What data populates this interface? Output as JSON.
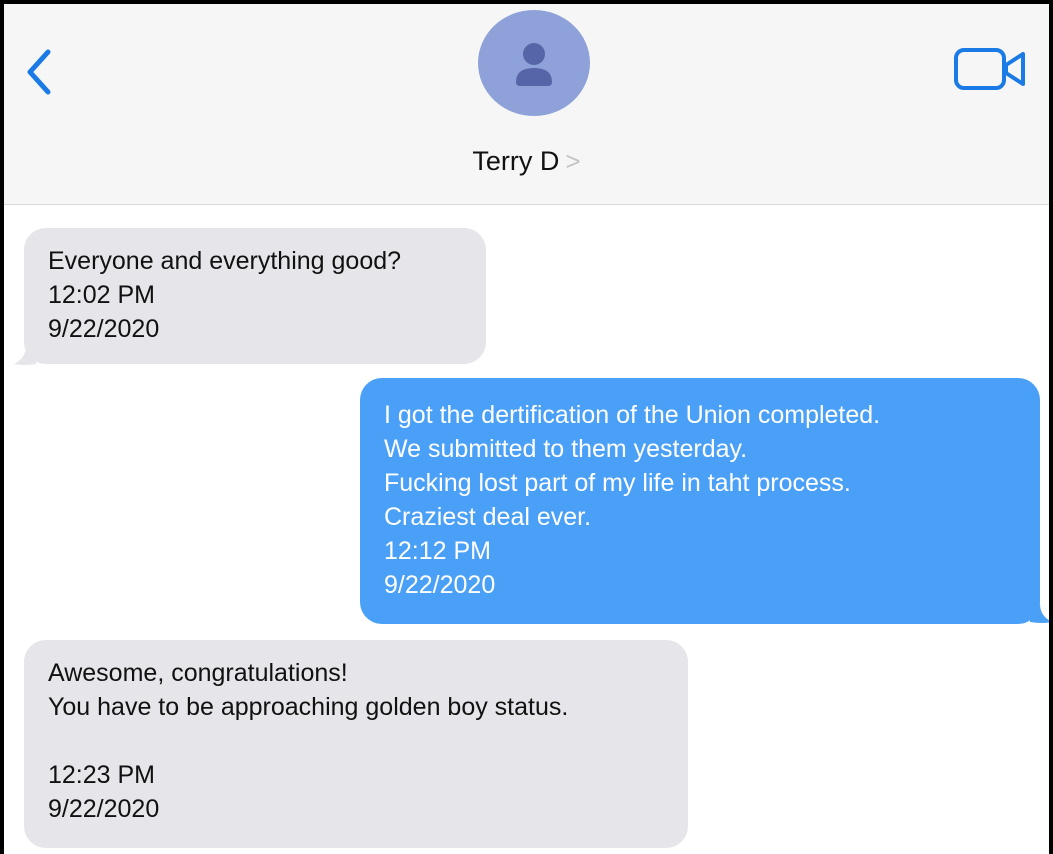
{
  "header": {
    "contact_name": "Terry D",
    "contact_chevron": ">",
    "back_icon": "chevron-left-icon",
    "video_icon": "video-camera-icon",
    "avatar_icon": "person-silhouette-icon",
    "accent_color": "#1a7ae6",
    "avatar_color": "#8ea2d9"
  },
  "messages": [
    {
      "direction": "incoming",
      "lines": [
        "Everyone and everything good?",
        "12:02 PM",
        "9/22/2020"
      ]
    },
    {
      "direction": "outgoing",
      "lines": [
        "I got the dertification of the Union completed.",
        "We submitted to them yesterday.",
        "Fucking lost part of my life in taht process.",
        "Craziest deal ever.",
        "12:12 PM",
        "9/22/2020"
      ]
    },
    {
      "direction": "incoming",
      "lines": [
        "Awesome, congratulations!",
        "You have to be approaching golden boy status.",
        "",
        "12:23 PM",
        "9/22/2020"
      ]
    }
  ],
  "colors": {
    "incoming_bubble": "#e5e5ea",
    "outgoing_bubble": "#4aa0f7",
    "header_bg": "#f6f6f6"
  }
}
